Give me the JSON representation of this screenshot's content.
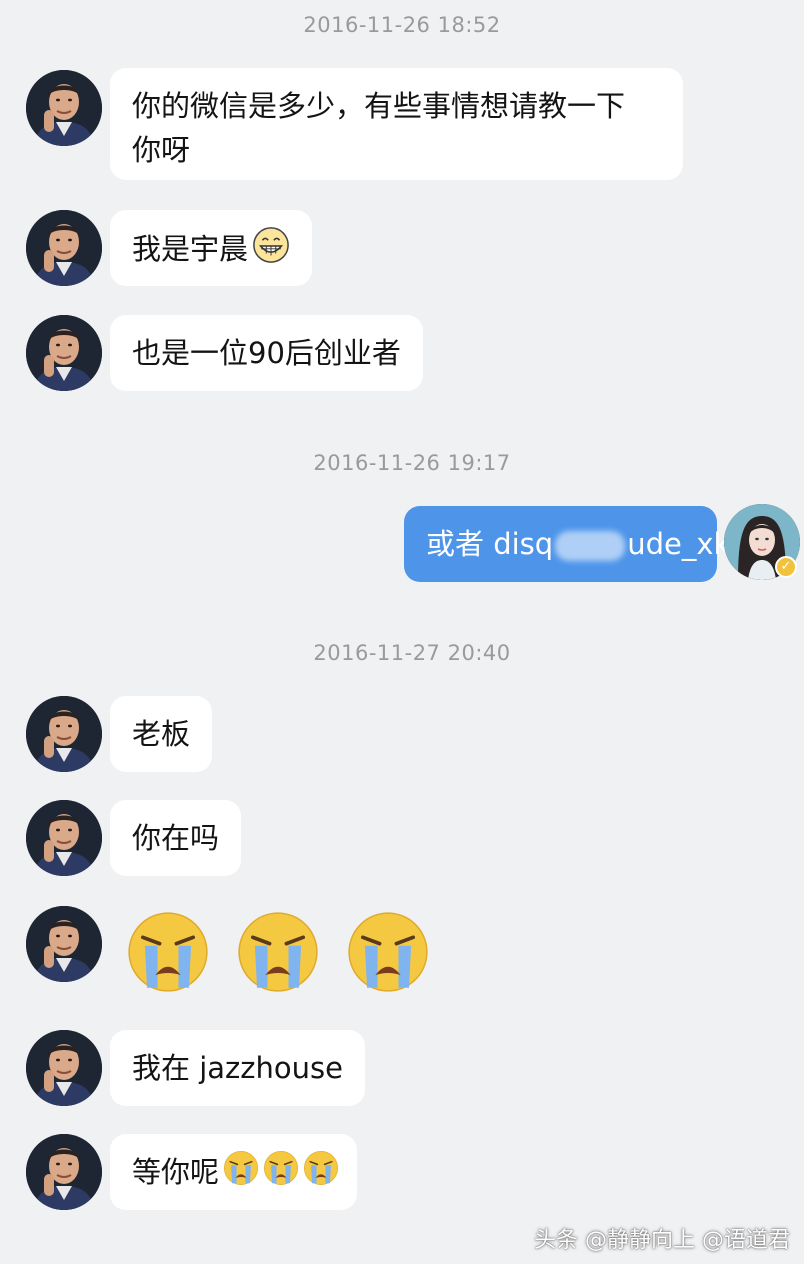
{
  "timestamps": [
    "2016-11-26 18:52",
    "2016-11-26 19:17",
    "2016-11-27 20:40"
  ],
  "messages": {
    "m1_line1": "你的微信是多少，有些事情想请教一下",
    "m1_line2": "你呀",
    "m2": "我是宇晨",
    "m3": "也是一位90后创业者",
    "m4_prefix": "或者 disq",
    "m4_suffix": "ude_xk",
    "m5": "老板",
    "m6": "你在吗",
    "m8": "我在 jazzhouse",
    "m9": "等你呢"
  },
  "icons": {
    "grin": "grinning-emoji-icon",
    "cry": "loudly-crying-emoji-icon",
    "verified": "verified-badge-icon"
  },
  "colors": {
    "background": "#f0f1f3",
    "incoming_bubble": "#ffffff",
    "outgoing_bubble": "#4e95ea",
    "timestamp": "#9a9a9a"
  },
  "watermark": "头条 @静静向上 @语道君"
}
